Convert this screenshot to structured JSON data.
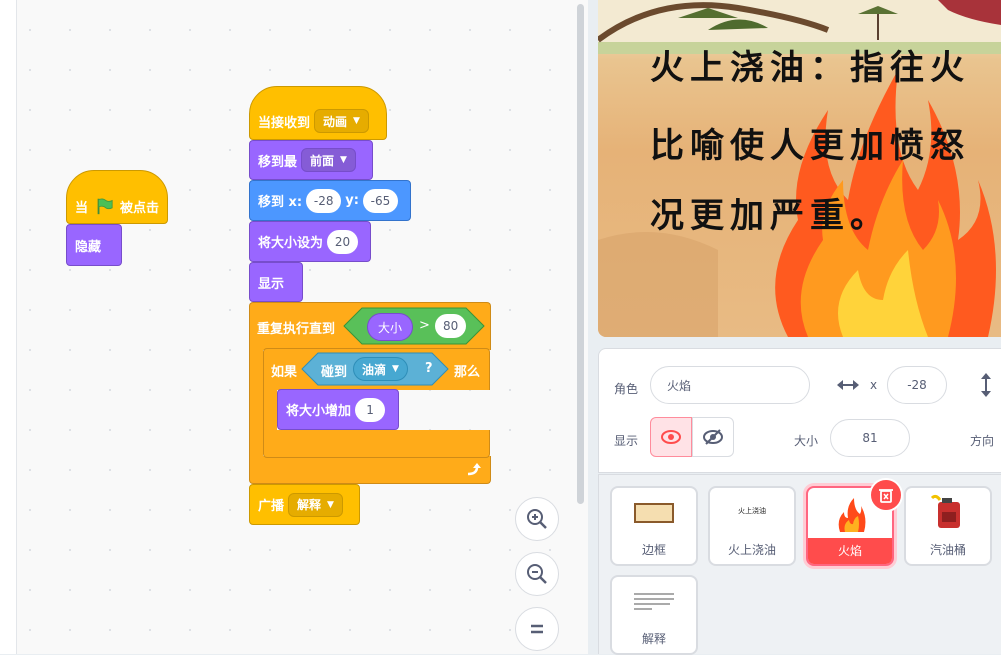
{
  "scripts": {
    "green_flag": {
      "when": "当",
      "clicked": "被点击",
      "hide": "隐藏"
    },
    "receive": {
      "when_receive": "当接收到",
      "message": "动画",
      "go_to": "移到最",
      "layer": "前面",
      "goto_xy": "移到 x:",
      "x": "-28",
      "y_label": "y:",
      "y": "-65",
      "set_size": "将大小设为",
      "size": "20",
      "show": "显示",
      "repeat_until": "重复执行直到",
      "size_reporter": "大小",
      "gt": ">",
      "gt_value": "80",
      "if": "如果",
      "touching": "碰到",
      "touch_target": "油滴",
      "question": "?",
      "then": "那么",
      "change_size": "将大小增加",
      "change_value": "1",
      "broadcast": "广播",
      "broadcast_msg": "解释"
    }
  },
  "stage": {
    "lines": [
      "火上浇油：指往火",
      "比喻使人更加愤怒",
      "况更加严重。"
    ]
  },
  "sprite_info": {
    "sprite_label": "角色",
    "sprite_name": "火焰",
    "x_label": "x",
    "x": "-28",
    "show_label": "显示",
    "size_label": "大小",
    "size": "81",
    "direction_label": "方向"
  },
  "sprites": [
    {
      "name": "边框",
      "selected": false
    },
    {
      "name": "火上浇油",
      "selected": false,
      "thumb_text": "火上浇油"
    },
    {
      "name": "火焰",
      "selected": true
    },
    {
      "name": "汽油桶",
      "selected": false
    },
    {
      "name": "解释",
      "selected": false
    }
  ],
  "icons": {
    "flag": "green-flag-icon",
    "eye": "eye-icon",
    "eye_off": "eye-off-icon",
    "zoom_in": "zoom-in-icon",
    "zoom_out": "zoom-out-icon",
    "reset": "zoom-reset-icon",
    "trash": "trash-icon",
    "arrows": "horizontal-arrows-icon",
    "loop": "loop-arrow-icon"
  },
  "colors": {
    "event": "#ffbf00",
    "looks": "#9966ff",
    "motion": "#4c97ff",
    "control": "#ffab19",
    "sensing": "#5cb1d6",
    "operator": "#59c059",
    "selected": "#ff4c4c"
  }
}
